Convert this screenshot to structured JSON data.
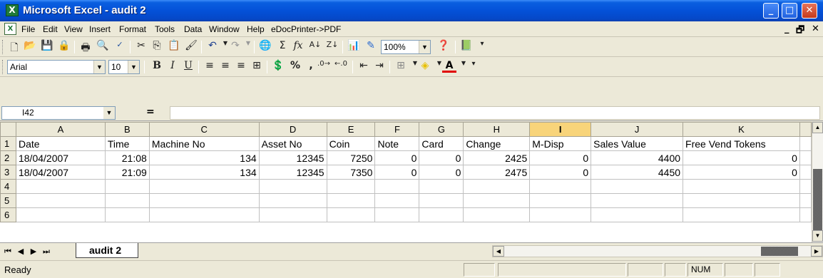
{
  "window": {
    "title": "Microsoft Excel - audit 2",
    "app_icon": "excel-app-icon",
    "controls": {
      "minimize": "_",
      "maximize": "□",
      "close": "✕"
    }
  },
  "menubar": {
    "items": [
      "File",
      "Edit",
      "View",
      "Insert",
      "Format",
      "Tools",
      "Data",
      "Window",
      "Help",
      "eDocPrinter->PDF"
    ],
    "doc_controls": {
      "minimize": "_",
      "restore": "🗗",
      "close": "✕"
    }
  },
  "standard_toolbar": {
    "zoom": "100%"
  },
  "formatting_toolbar": {
    "font": "Arial",
    "size": "10"
  },
  "formula_bar": {
    "name_box": "I42",
    "eq": "=",
    "value": ""
  },
  "grid": {
    "columns": [
      "A",
      "B",
      "C",
      "D",
      "E",
      "F",
      "G",
      "H",
      "I",
      "J",
      "K"
    ],
    "active_column": "I",
    "rows": [
      {
        "num": "1",
        "cells": [
          "Date",
          "Time",
          "Machine No",
          "Asset No",
          "Coin",
          "Note",
          "Card",
          "Change",
          "M-Disp",
          "Sales Value",
          "Free Vend Tokens"
        ]
      },
      {
        "num": "2",
        "cells": [
          "18/04/2007",
          "21:08",
          "134",
          "12345",
          "7250",
          "0",
          "0",
          "2425",
          "0",
          "4400",
          "0"
        ]
      },
      {
        "num": "3",
        "cells": [
          "18/04/2007",
          "21:09",
          "134",
          "12345",
          "7350",
          "0",
          "0",
          "2475",
          "0",
          "4450",
          "0"
        ]
      },
      {
        "num": "4",
        "cells": [
          "",
          "",
          "",
          "",
          "",
          "",
          "",
          "",
          "",
          "",
          ""
        ]
      },
      {
        "num": "5",
        "cells": [
          "",
          "",
          "",
          "",
          "",
          "",
          "",
          "",
          "",
          "",
          ""
        ]
      },
      {
        "num": "6",
        "cells": [
          "",
          "",
          "",
          "",
          "",
          "",
          "",
          "",
          "",
          "",
          ""
        ]
      }
    ]
  },
  "sheets": {
    "active": "audit 2"
  },
  "statusbar": {
    "status": "Ready",
    "num": "NUM"
  }
}
